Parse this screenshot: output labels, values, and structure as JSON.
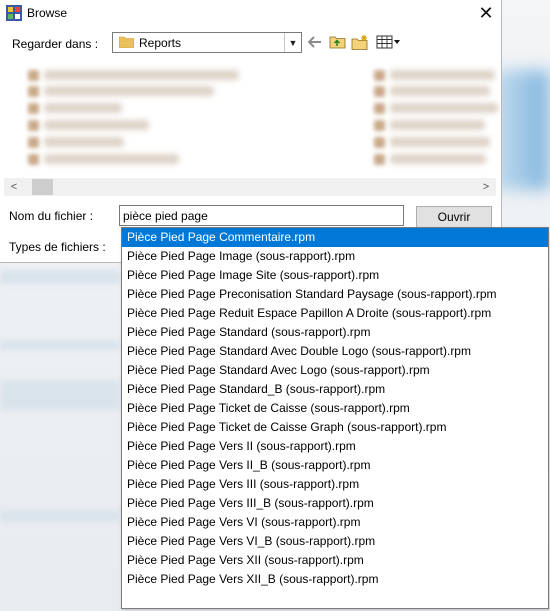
{
  "dialog": {
    "title": "Browse",
    "look_in_label": "Regarder dans :",
    "look_in_value": "Reports",
    "filename_label": "Nom du fichier :",
    "filename_value": "pièce pied page",
    "filetypes_label": "Types de fichiers :",
    "open_button": "Ouvrir"
  },
  "toolbar_icons": [
    "back-arrow-icon",
    "up-folder-icon",
    "new-folder-icon",
    "view-menu-icon"
  ],
  "autocomplete": {
    "selected_index": 0,
    "items": [
      "Pièce Pied Page Commentaire.rpm",
      "Pièce Pied Page Image (sous-rapport).rpm",
      "Pièce Pied Page Image Site (sous-rapport).rpm",
      "Pièce Pied Page Preconisation Standard Paysage (sous-rapport).rpm",
      "Pièce Pied Page Reduit Espace Papillon A Droite (sous-rapport).rpm",
      "Pièce Pied Page Standard (sous-rapport).rpm",
      "Pièce Pied Page Standard Avec Double Logo (sous-rapport).rpm",
      "Pièce Pied Page Standard Avec Logo (sous-rapport).rpm",
      "Pièce Pied Page Standard_B (sous-rapport).rpm",
      "Pièce Pied Page Ticket de Caisse (sous-rapport).rpm",
      "Pièce Pied Page Ticket de Caisse Graph (sous-rapport).rpm",
      "Pièce Pied Page Vers II (sous-rapport).rpm",
      "Pièce Pied Page Vers II_B (sous-rapport).rpm",
      "Pièce Pied Page Vers III (sous-rapport).rpm",
      "Pièce Pied Page Vers III_B (sous-rapport).rpm",
      "Pièce Pied Page Vers VI (sous-rapport).rpm",
      "Pièce Pied Page Vers VI_B (sous-rapport).rpm",
      "Pièce Pied Page Vers XII (sous-rapport).rpm",
      "Pièce Pied Page Vers XII_B (sous-rapport).rpm"
    ]
  },
  "colors": {
    "selection": "#0078d7",
    "folder": "#e8c15a"
  }
}
